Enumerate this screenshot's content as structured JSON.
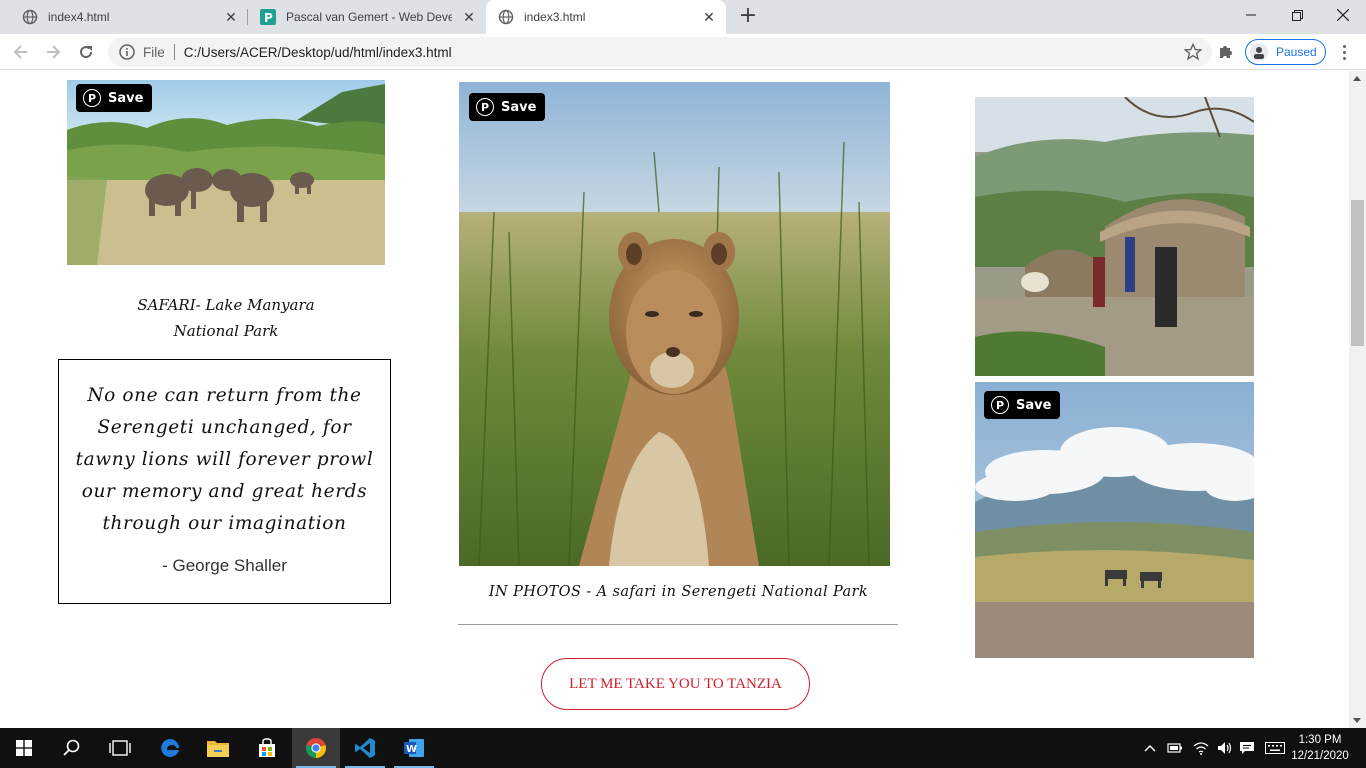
{
  "browser": {
    "tabs": [
      {
        "title": "index4.html",
        "favicon": "globe-icon",
        "active": false
      },
      {
        "title": "Pascal van Gemert - Web Develo",
        "favicon": "p-favicon-icon",
        "active": false
      },
      {
        "title": "index3.html",
        "favicon": "globe-icon",
        "active": true
      }
    ],
    "new_tab_label": "+",
    "address": {
      "scheme_label": "File",
      "url": "C:/Users/ACER/Desktop/ud/html/index3.html"
    },
    "profile_label": "Paused"
  },
  "page": {
    "left": {
      "pin_save_label": "Save",
      "caption_line1": "SAFARI- Lake Manyara",
      "caption_line2": "National Park",
      "quote": "No one can return from the Serengeti unchanged, for tawny lions will forever prowl our memory and great herds through our imagination",
      "quote_author": "- George Shaller"
    },
    "center": {
      "pin_save_label": "Save",
      "caption": "IN PHOTOS - A safari in Serengeti National Park",
      "cta_label": "LET ME TAKE YOU TO TANZIA"
    },
    "right": {
      "pin_save_label": "Save"
    }
  },
  "taskbar": {
    "apps": [
      "windows-start-icon",
      "search-icon",
      "task-view-icon",
      "edge-icon",
      "file-explorer-icon",
      "store-icon",
      "chrome-icon",
      "vscode-icon",
      "word-icon"
    ],
    "time": "1:30 PM",
    "date": "12/21/2020"
  },
  "colors": {
    "accent_red": "#d01f2a",
    "profile_blue": "#1a73e8",
    "pinterest_black": "#000000"
  }
}
